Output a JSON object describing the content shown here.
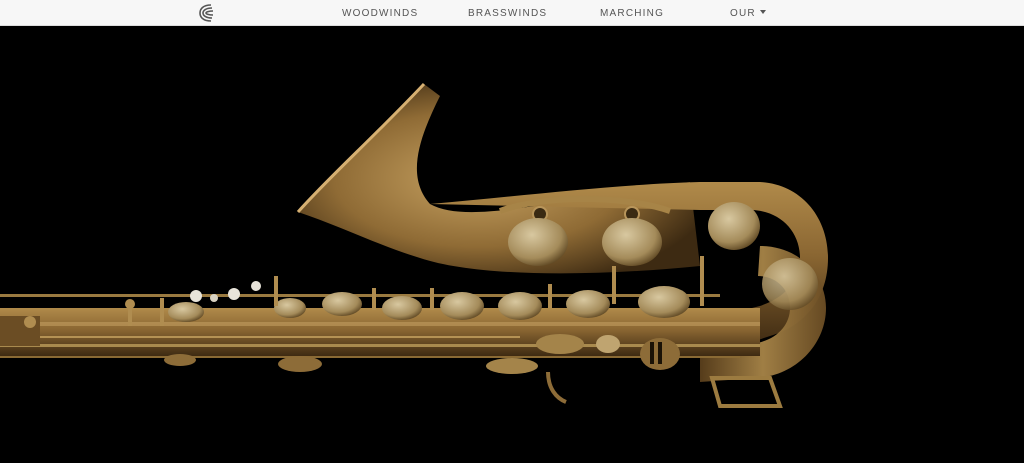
{
  "nav": {
    "items": [
      {
        "label": "WOODWINDS"
      },
      {
        "label": "BRASSWINDS"
      },
      {
        "label": "MARCHING"
      },
      {
        "label": "OUR"
      }
    ]
  },
  "colors": {
    "nav_bg": "#f7f7f7",
    "nav_text": "#555555",
    "hero_bg": "#000000",
    "brass": "#8a6a34"
  },
  "icons": {
    "logo": "company-logo-icon",
    "dropdown": "chevron-down-icon"
  }
}
